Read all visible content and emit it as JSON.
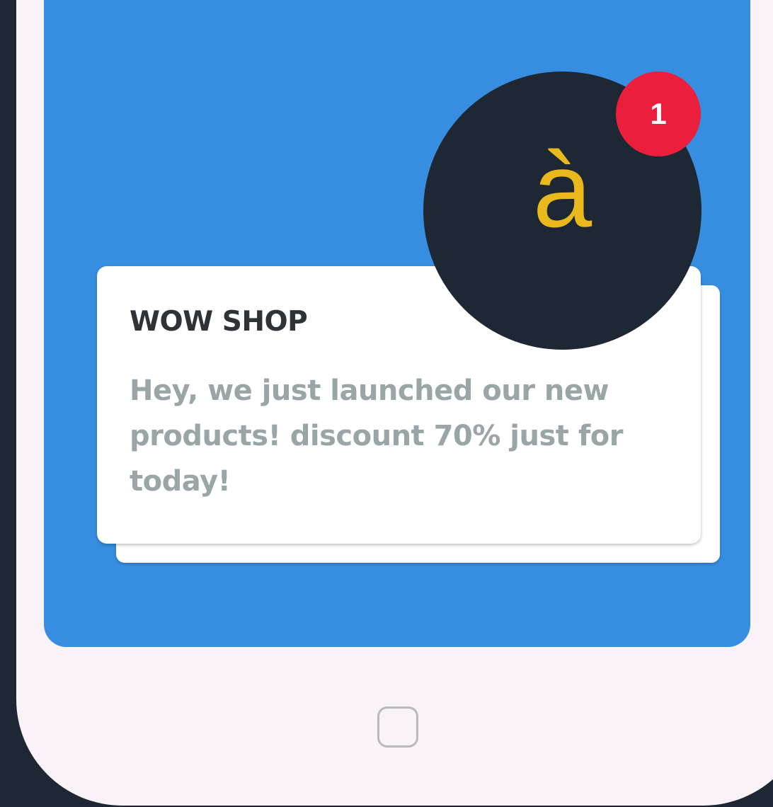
{
  "notification": {
    "title": "WOW SHOP",
    "message": "Hey, we just launched our new products! discount 70% just for today!"
  },
  "app_icon": {
    "glyph": "à",
    "icon_name": "app-logo-icon",
    "glyph_color": "#e8b81c",
    "background_color": "#1e2835"
  },
  "badge": {
    "count": "1",
    "color": "#eb1f3b"
  },
  "device": {
    "home_button_icon": "rounded-square-home-icon",
    "frame_color": "#f9f3f7",
    "screen_color": "#378ee0"
  }
}
